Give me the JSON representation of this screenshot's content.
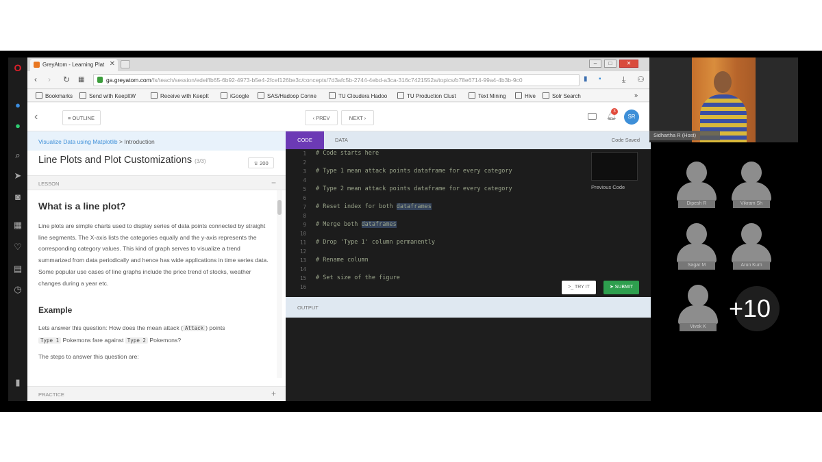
{
  "browser": {
    "tab_title": "GreyAtom - Learning Plat",
    "tab_close": "✕",
    "url_domain": "ga.greyatom.com",
    "url_path": "/fs/teach/session/edeiffb65-6b92-4973-b5e4-2fcef126be3c/concepts/7d3afc5b-2744-4ebd-a3ca-316c7421552a/topics/b78e6714-99a4-4b3b-9c0",
    "bookmarks": [
      "Bookmarks",
      "Send with KeepItW",
      "Receive with KeepIt",
      "iGoogle",
      "SAS/Hadoop Conne",
      "TU Cloudera Hadoo",
      "TU Production Clust",
      "Text Mining",
      "Hive",
      "Solr Search"
    ],
    "bookmarks_more": "»"
  },
  "header": {
    "outline_label": "OUTLINE",
    "prev_label": "PREV",
    "next_label": "NEXT",
    "notification_count": "3",
    "avatar_initials": "SR"
  },
  "lesson": {
    "breadcrumb_1": "Visualize Data using Matplotlib",
    "breadcrumb_sep": ">",
    "breadcrumb_2": "Introduction",
    "title": "Line Plots and Plot Customizations",
    "count": "(3/3)",
    "points": "200",
    "section_label": "LESSON",
    "heading": "What is a line plot?",
    "description": "Line plots are simple charts used to display series of data points connected by straight line segments. The X-axis lists the categories equally and the y-axis represents the corresponding category values. This kind of graph serves to visualize a trend summarized from data periodically and hence has wide applications in time series data. Some popular use cases of line graphs include the price trend of stocks, weather changes during a year etc.",
    "example_heading": "Example",
    "example_text_1": "Lets answer this question: How does the mean attack (",
    "example_code_1": "Attack",
    "example_text_2": ") points",
    "example_code_2": "Type 1",
    "example_text_3": "Pokemons fare against",
    "example_code_3": "Type 2",
    "example_text_4": "Pokemons?",
    "steps_text": "The steps to answer this question are:",
    "practice_label": "PRACTICE"
  },
  "code": {
    "tab_code": "CODE",
    "tab_data": "DATA",
    "saved_status": "Code Saved",
    "line_numbers": [
      "1",
      "2",
      "3",
      "4",
      "5",
      "6",
      "7",
      "8",
      "9",
      "10",
      "11",
      "12",
      "13",
      "14",
      "15",
      "16"
    ],
    "lines": {
      "l1": "# Code starts here",
      "l3": "# Type 1 mean attack points dataframe for every category",
      "l5": "# Type 2 mean attack points dataframe for every category",
      "l7a": "# Reset index for both ",
      "l7b": "dataframes",
      "l9a": "# Merge both ",
      "l9b": "dataframes",
      "l11": "# Drop 'Type 1' column permanently",
      "l13": "# Rename column",
      "l15": "# Set size of the figure"
    },
    "previous_code_label": "Previous Code",
    "tryit_label": "TRY IT",
    "submit_label": "SUBMIT",
    "output_label": "OUTPUT"
  },
  "call": {
    "speaker_name": "Sidhartha R (Host)",
    "participants": [
      "Dipesh R",
      "Vikram Sh",
      "Sagar M",
      "Arun Kum",
      "Vivek K"
    ],
    "more_count": "+10"
  },
  "colors": {
    "accent_purple": "#6c3ab5",
    "submit_green": "#2e9f4e",
    "link_blue": "#3d8fd8"
  }
}
